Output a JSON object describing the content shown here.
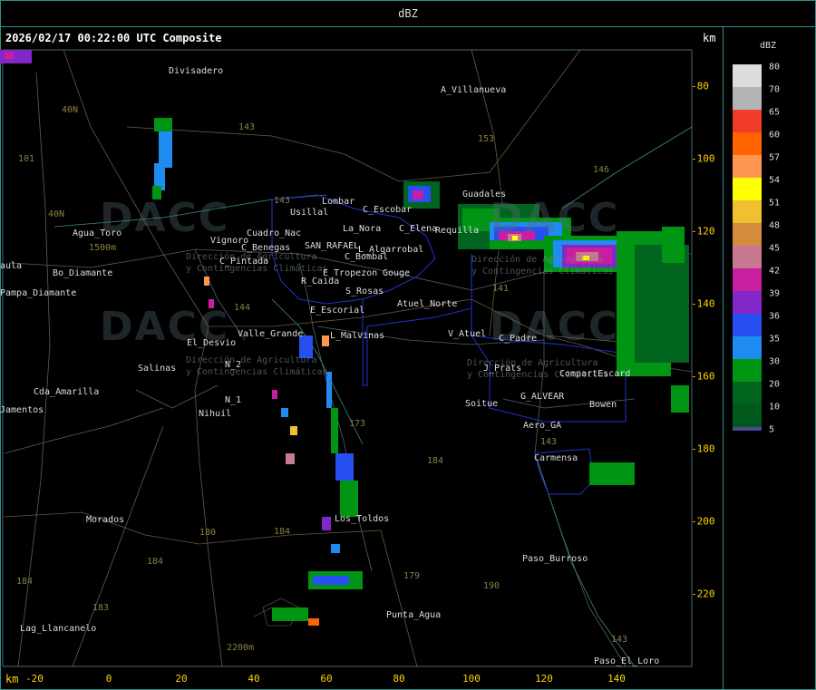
{
  "header": {
    "product": "dBZ"
  },
  "map": {
    "timestamp": "2026/02/17 00:22:00 UTC Composite",
    "km_top": "km",
    "km_bottom": "km",
    "x_ticks": [
      "-20",
      "0",
      "20",
      "40",
      "60",
      "80",
      "100",
      "120",
      "140"
    ],
    "y_ticks": [
      "-80",
      "-100",
      "-120",
      "-140",
      "-160",
      "-180",
      "-200",
      "-220"
    ],
    "places": [
      "Divisadero",
      "A_Villanueva",
      "Usillal",
      "Lombar",
      "C_Escobar",
      "La_Nora",
      "C_Benegas",
      "SAN_RAFAEL",
      "L_Algarrobal",
      "C_Bombal",
      "C_Pintada",
      "Vignoro",
      "Cuadro_Nac",
      "E_Tropezon",
      "Gouge",
      "R_Caida",
      "S_Rosas",
      "Atuel_Norte",
      "E_Escorial",
      "Valle_Grande",
      "L_Malvinas",
      "El_Desvio",
      "Salinas",
      "N_2",
      "N_1",
      "Nihuil",
      "Cda_Amarilla",
      "Agua_Toro",
      "Bo_Diamante",
      "Pampa_Diamante",
      "Guadales",
      "C_Elena",
      "Requilla",
      "V_Atuel",
      "C_Padre",
      "J_Prats",
      "CompartEscard",
      "G_ALVEAR",
      "Bowen",
      "Soitue",
      "Aero_GA",
      "Carmensa",
      "Los_Toldos",
      "Morados",
      "Punta_Agua",
      "Paso_Burroso",
      "Paso_El_Loro",
      "Lag_Llancanelo",
      "Jamentos",
      "aula"
    ],
    "routes": [
      "40N",
      "40N",
      "101",
      "143",
      "153",
      "146",
      "143",
      "144",
      "141",
      "173",
      "184",
      "184",
      "180",
      "184",
      "184",
      "183",
      "179",
      "190",
      "143",
      "143"
    ],
    "elevations": [
      "1500m",
      "2200m"
    ],
    "watermark": {
      "brand": "DACC",
      "line1": "Dirección de Agricultura",
      "line2": "y Contingencias Climáticas"
    }
  },
  "legend": {
    "unit": "dBZ",
    "levels": [
      {
        "label": "80",
        "color": "#dcdcdc"
      },
      {
        "label": "70",
        "color": "#b4b4b4"
      },
      {
        "label": "65",
        "color": "#f03c28"
      },
      {
        "label": "60",
        "color": "#ff6400"
      },
      {
        "label": "57",
        "color": "#ff9650"
      },
      {
        "label": "54",
        "color": "#ffff00"
      },
      {
        "label": "51",
        "color": "#f0c030"
      },
      {
        "label": "48",
        "color": "#d28c3c"
      },
      {
        "label": "45",
        "color": "#c87890"
      },
      {
        "label": "42",
        "color": "#c81ea0"
      },
      {
        "label": "39",
        "color": "#8228c8"
      },
      {
        "label": "36",
        "color": "#2850f0"
      },
      {
        "label": "35",
        "color": "#1e8cf0"
      },
      {
        "label": "30",
        "color": "#009614"
      },
      {
        "label": "20",
        "color": "#00641e"
      },
      {
        "label": "10",
        "color": "#005a1e"
      },
      {
        "label": "5",
        "color": "#504696"
      }
    ]
  }
}
